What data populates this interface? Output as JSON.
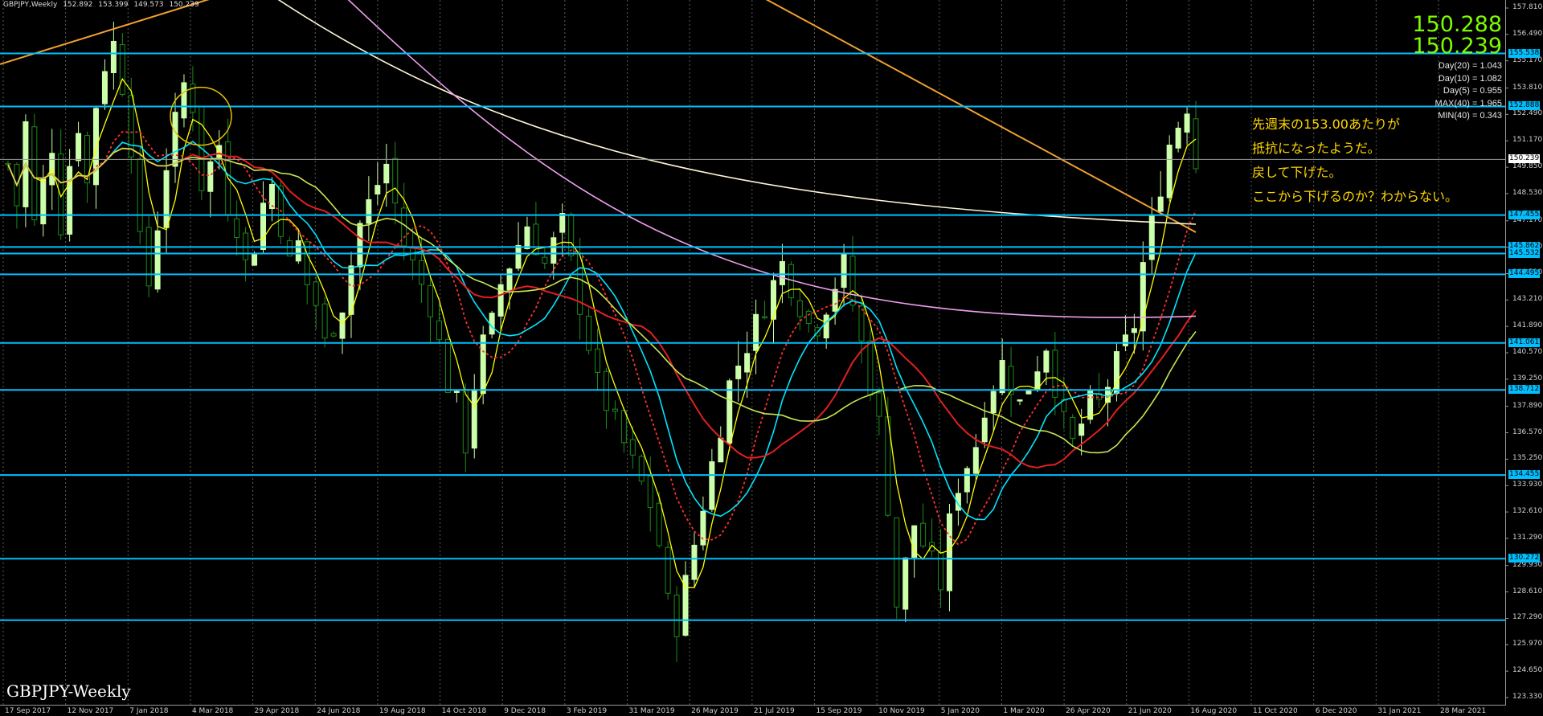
{
  "header": {
    "symbol": "GBPJPY,Weekly",
    "open": "152.892",
    "high": "153.399",
    "low": "149.573",
    "close": "150.239"
  },
  "price_display": {
    "bid": "150.288",
    "ask": "150.239"
  },
  "stats": [
    "Day(20) = 1.043",
    "Day(10) = 1.082",
    "Day(5) = 0.955",
    "MAX(40) = 1.965",
    "MIN(40) = 0.343"
  ],
  "note": [
    "先週末の153.00あたりが",
    "抵抗になったようだ。",
    "戻して下げた。",
    "ここから下げるのか？わからない。"
  ],
  "watermark": "GBPJPY-Weekly",
  "colors": {
    "background": "#000000",
    "bull": "#ccffaa",
    "bear": "#1a8c1a",
    "hline": "#00bfff",
    "note": "#ffd700",
    "price": "#7cfc00"
  },
  "chart_data": {
    "type": "candlestick",
    "symbol": "GBPJPY",
    "timeframe": "Weekly",
    "ylim": [
      123.33,
      157.81
    ],
    "y_ticks": [
      "157.810",
      "156.490",
      "155.170",
      "153.810",
      "152.490",
      "151.170",
      "149.850",
      "148.530",
      "147.170",
      "145.850",
      "144.530",
      "143.210",
      "141.890",
      "140.570",
      "139.250",
      "137.890",
      "136.570",
      "135.250",
      "133.930",
      "132.610",
      "131.290",
      "129.930",
      "128.610",
      "127.290",
      "125.970",
      "124.650",
      "123.330"
    ],
    "x_labels": [
      "17 Sep 2017",
      "12 Nov 2017",
      "7 Jan 2018",
      "4 Mar 2018",
      "29 Apr 2018",
      "24 Jun 2018",
      "19 Aug 2018",
      "14 Oct 2018",
      "9 Dec 2018",
      "3 Feb 2019",
      "31 Mar 2019",
      "26 May 2019",
      "21 Jul 2019",
      "15 Sep 2019",
      "10 Nov 2019",
      "5 Jan 2020",
      "1 Mar 2020",
      "26 Apr 2020",
      "21 Jun 2020",
      "16 Aug 2020",
      "11 Oct 2020",
      "6 Dec 2020",
      "31 Jan 2021",
      "28 Mar 2021"
    ],
    "horizontal_lines": [
      "155.538",
      "152.888",
      "147.455",
      "145.862",
      "145.532",
      "144.495",
      "141.061",
      "138.712",
      "134.455",
      "130.272",
      "127.200"
    ],
    "current_price": "150.239",
    "path": [
      150,
      148,
      152,
      147,
      149,
      151,
      147,
      150,
      152,
      149,
      153,
      155,
      156,
      154,
      151,
      146,
      144,
      147,
      150,
      152,
      154,
      153,
      149,
      150,
      151,
      148,
      147,
      145,
      146,
      148,
      149,
      147,
      145,
      146,
      144,
      143,
      141,
      142,
      143,
      145,
      147,
      148,
      149,
      150,
      148,
      146,
      145,
      144,
      143,
      141,
      139,
      138,
      136,
      139,
      141,
      142,
      144,
      145,
      146,
      147,
      146,
      145,
      146,
      147,
      145,
      143,
      141,
      139,
      138,
      137,
      136,
      135,
      134,
      133,
      131,
      128,
      127,
      129,
      131,
      133,
      135,
      137,
      139,
      140,
      141,
      142,
      143,
      144,
      145,
      144,
      143,
      142,
      142,
      143,
      144,
      145,
      143,
      141,
      139,
      137,
      133,
      128,
      130,
      132,
      131,
      130,
      129,
      132,
      134,
      135,
      136,
      138,
      139,
      140,
      139,
      138,
      139,
      140,
      141,
      139,
      137,
      136,
      137,
      138,
      138,
      139,
      140,
      141,
      142,
      145,
      147,
      149,
      151,
      152,
      153,
      150
    ]
  }
}
